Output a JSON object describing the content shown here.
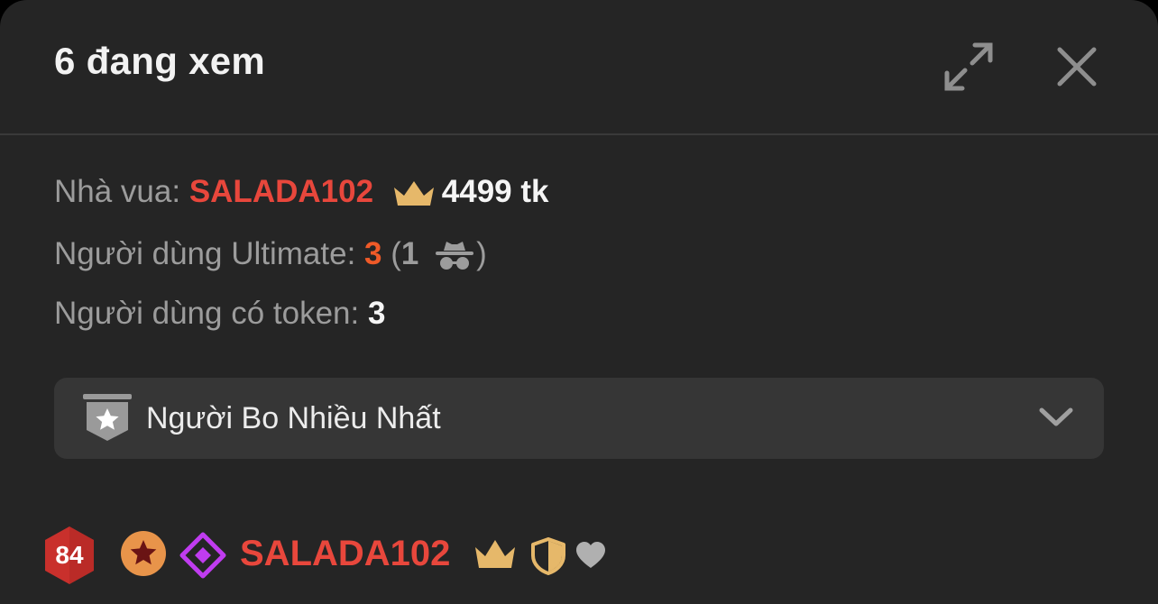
{
  "header": {
    "title": "6 đang xem",
    "expand_icon": "expand-icon",
    "close_icon": "close-icon"
  },
  "info": {
    "king_label": "Nhà vua: ",
    "king_name": "SALADA102",
    "king_tokens": "4499 tk",
    "ultimate_label": "Người dùng Ultimate: ",
    "ultimate_count": "3",
    "ultimate_open": " (",
    "anonymous_count": "1",
    "ultimate_close": ")",
    "token_users_label": "Người dùng có token: ",
    "token_users_count": "3"
  },
  "dropdown": {
    "label": "Người Bo Nhiều Nhất",
    "icon": "ribbon-star-icon",
    "chevron": "chevron-down-icon"
  },
  "user": {
    "level": "84",
    "name": "SALADA102"
  },
  "colors": {
    "panel_bg": "#252525",
    "dropdown_bg": "#363636",
    "king_red": "#e8473c",
    "ultimate_orange": "#ef5a28",
    "crown_gold": "#e6b86a",
    "level_red": "#c9302c",
    "diamond_purple": "#c03cf0",
    "star_orange": "#e8944a"
  }
}
